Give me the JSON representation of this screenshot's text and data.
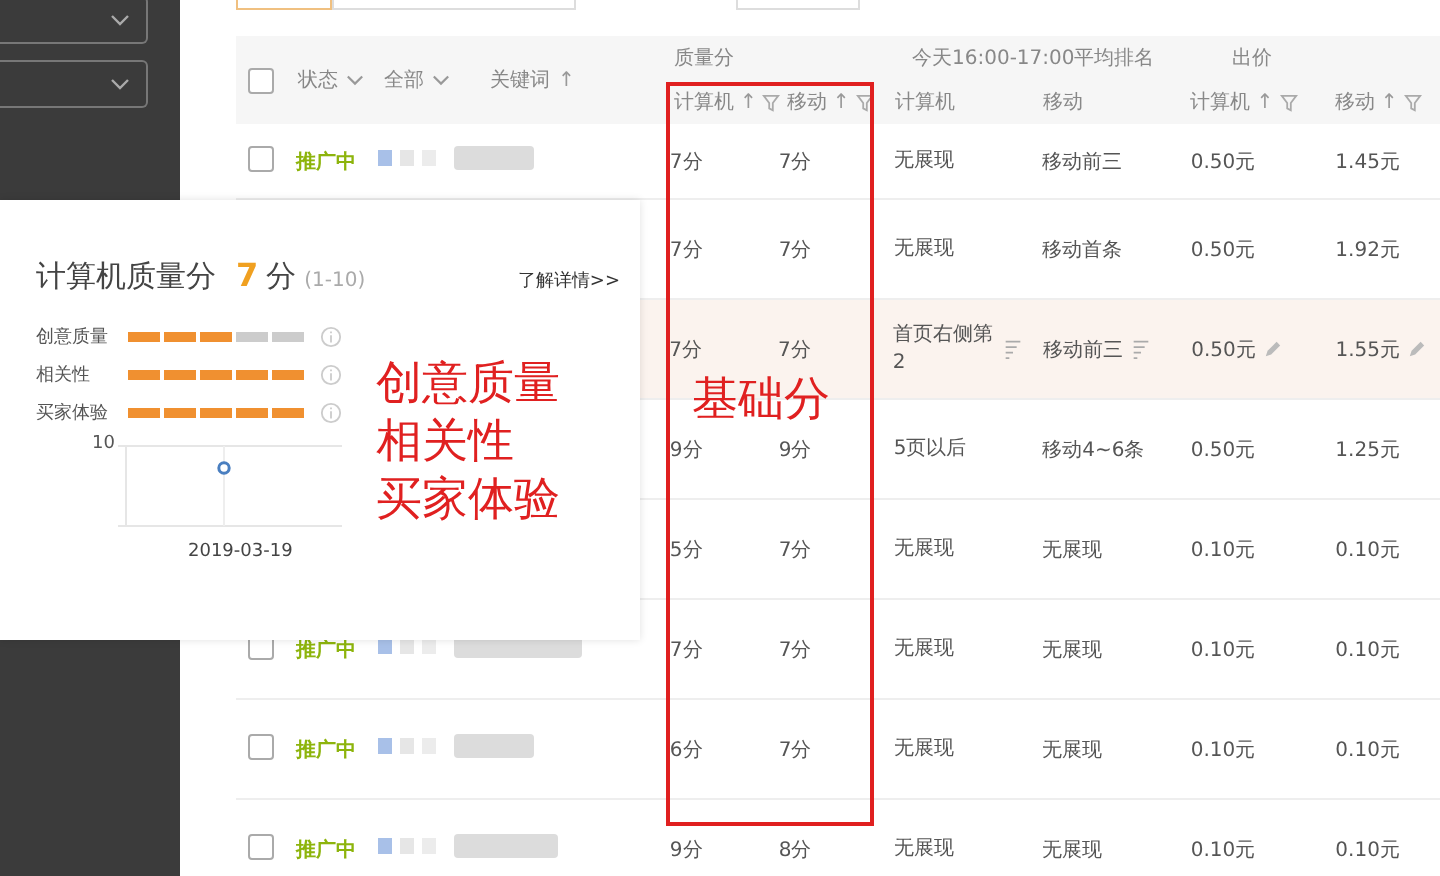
{
  "table": {
    "header": {
      "status": "状态",
      "scope": "全部",
      "keyword": "关键词",
      "keyword_sort": "↑",
      "checked": false
    },
    "groups": [
      "质量分",
      "今天16:00-17:00平均排名",
      "出价"
    ],
    "subheaders": [
      {
        "label": "计算机",
        "kind": "sortable",
        "sort": "↑"
      },
      {
        "label": "移动",
        "kind": "sortable",
        "sort": "↑"
      },
      {
        "label": "计算机",
        "kind": "plain"
      },
      {
        "label": "移动",
        "kind": "plain"
      },
      {
        "label": "计算机",
        "kind": "sortable",
        "sort": "↑"
      },
      {
        "label": "移动",
        "kind": "sortable",
        "sort": "↑"
      }
    ],
    "rows": [
      {
        "checked": false,
        "status": "推广中",
        "highlighted": false,
        "quality_pc": "7分",
        "quality_mobile": "7分",
        "rank_pc": "无展现",
        "rank_mobile": "移动前三",
        "bid_pc": "0.50元",
        "bid_mobile": "1.45元"
      },
      {
        "highlighted": false,
        "quality_pc": "7分",
        "quality_mobile": "7分",
        "rank_pc": "无展现",
        "rank_mobile": "移动首条",
        "bid_pc": "0.50元",
        "bid_mobile": "1.92元"
      },
      {
        "highlighted": true,
        "quality_pc": "7分",
        "quality_mobile": "7分",
        "rank_pc": "首页右侧第2",
        "rank_mobile": "移动前三",
        "bid_pc": "0.50元",
        "bid_mobile": "1.55元"
      },
      {
        "highlighted": false,
        "quality_pc": "9分",
        "quality_mobile": "9分",
        "rank_pc": "5页以后",
        "rank_mobile": "移动4~6条",
        "bid_pc": "0.50元",
        "bid_mobile": "1.25元"
      },
      {
        "highlighted": false,
        "quality_pc": "5分",
        "quality_mobile": "7分",
        "rank_pc": "无展现",
        "rank_mobile": "无展现",
        "bid_pc": "0.10元",
        "bid_mobile": "0.10元"
      },
      {
        "checked": false,
        "status": "推广中",
        "highlighted": false,
        "quality_pc": "7分",
        "quality_mobile": "7分",
        "rank_pc": "无展现",
        "rank_mobile": "无展现",
        "bid_pc": "0.10元",
        "bid_mobile": "0.10元"
      },
      {
        "checked": false,
        "status": "推广中",
        "highlighted": false,
        "quality_pc": "6分",
        "quality_mobile": "7分",
        "rank_pc": "无展现",
        "rank_mobile": "无展现",
        "bid_pc": "0.10元",
        "bid_mobile": "0.10元"
      },
      {
        "checked": false,
        "status": "推广中",
        "highlighted": false,
        "quality_pc": "9分",
        "quality_mobile": "8分",
        "rank_pc": "无展现",
        "rank_mobile": "无展现",
        "bid_pc": "0.10元",
        "bid_mobile": "0.10元"
      }
    ]
  },
  "popup": {
    "title": "计算机质量分",
    "score": "7",
    "unit": "分",
    "range": "(1-10)",
    "link": "了解详情>>",
    "metrics": [
      {
        "label": "创意质量",
        "level": 0.6
      },
      {
        "label": "相关性",
        "level": 1
      },
      {
        "label": "买家体验",
        "level": 1
      }
    ],
    "chart": {
      "y_tick": "10",
      "x_label": "2019-03-19"
    }
  },
  "annotations": {
    "popup_note": [
      "创意质量",
      "相关性",
      "买家体验"
    ],
    "box_note": "基础分"
  }
}
